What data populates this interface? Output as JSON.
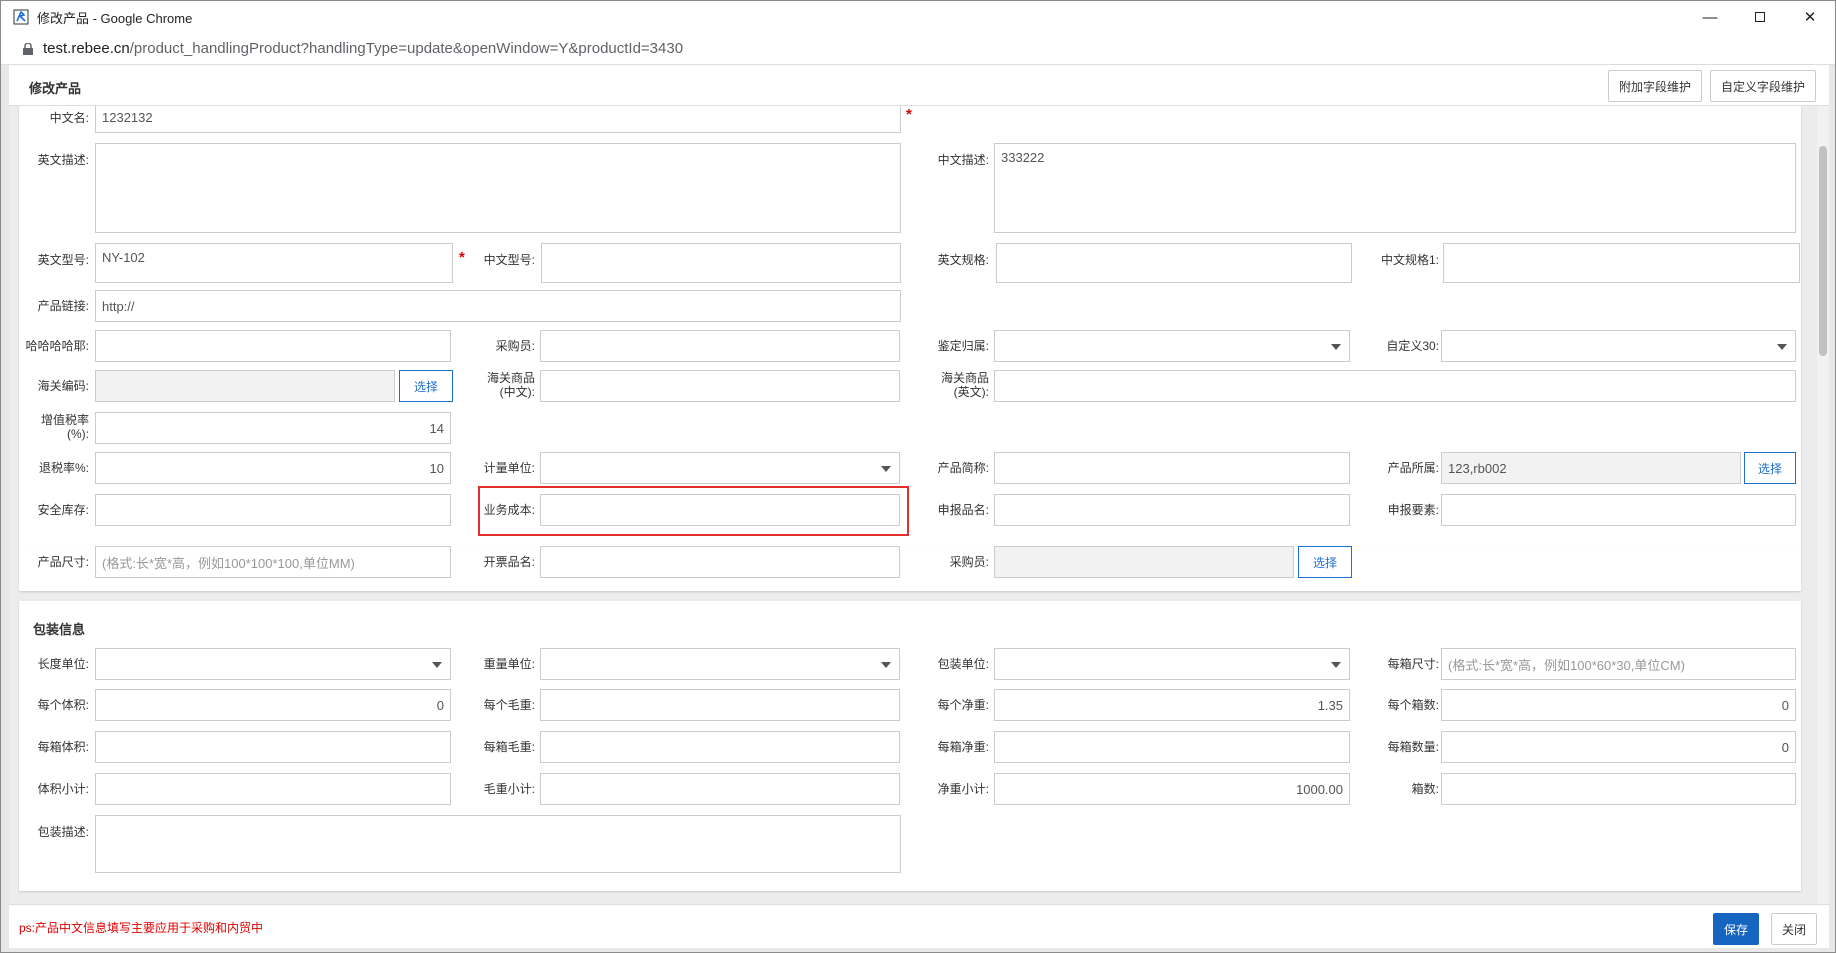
{
  "window": {
    "title": "修改产品 - Google Chrome",
    "url_host": "test.rebee.cn",
    "url_path": "/product_handlingProduct?handlingType=update&openWindow=Y&productId=3430"
  },
  "header": {
    "title": "修改产品",
    "extra_btn": "附加字段维护",
    "custom_btn": "自定义字段维护"
  },
  "basic": {
    "cn_name_label": "中文名:",
    "cn_name": "1232132",
    "required_mark": "*",
    "en_desc_label": "英文描述:",
    "en_desc": "",
    "cn_desc_label": "中文描述:",
    "cn_desc": "333222",
    "en_model_label": "英文型号:",
    "en_model": "NY-102",
    "cn_model_label": "中文型号:",
    "cn_model": "",
    "en_spec_label": "英文规格:",
    "en_spec": "",
    "cn_spec_label": "中文规格1:",
    "cn_spec": "",
    "link_label": "产品链接:",
    "link": "http://",
    "haha_label": "哈哈哈哈耶:",
    "haha": "",
    "buyer_label": "采购员:",
    "buyer": "",
    "identify_label": "鉴定归属:",
    "identify": "",
    "custom30_label": "自定义30:",
    "custom30": "",
    "hs_label": "海关编码:",
    "hs": "",
    "select_btn": "选择",
    "customs_cn_label_1": "海关商品",
    "customs_cn_label_2": "(中文):",
    "customs_cn": "",
    "customs_en_label_1": "海关商品",
    "customs_en_label_2": "(英文):",
    "customs_en": "",
    "vat_label_1": "增值税率",
    "vat_label_2": "(%):",
    "vat": "14",
    "rebate_label": "退税率%:",
    "rebate": "10",
    "unit_label": "计量单位:",
    "unit": "",
    "short_label": "产品简称:",
    "short": "",
    "owner_label": "产品所属:",
    "owner": "123,rb002",
    "stock_label": "安全库存:",
    "stock": "",
    "cost_label": "业务成本:",
    "cost": "",
    "declare_label": "申报品名:",
    "declare": "",
    "elements_label": "申报要素:",
    "elements": "",
    "size_label": "产品尺寸:",
    "size_placeholder": "(格式:长*宽*高，例如100*100*100,单位MM)",
    "invoice_label": "开票品名:",
    "invoice": "",
    "buyer2_label": "采购员:",
    "buyer2": ""
  },
  "packing": {
    "title": "包装信息",
    "len_unit_label": "长度单位:",
    "weight_unit_label": "重量单位:",
    "pack_unit_label": "包装单位:",
    "box_size_label": "每箱尺寸:",
    "box_size_placeholder": "(格式:长*宽*高，例如100*60*30,单位CM)",
    "unit_vol_label": "每个体积:",
    "unit_vol": "0",
    "unit_gross_label": "每个毛重:",
    "unit_gross": "",
    "unit_net_label": "每个净重:",
    "unit_net": "1.35",
    "unit_boxes_label": "每个箱数:",
    "unit_boxes": "0",
    "box_vol_label": "每箱体积:",
    "box_vol": "",
    "box_gross_label": "每箱毛重:",
    "box_gross": "",
    "box_net_label": "每箱净重:",
    "box_net": "",
    "box_qty_label": "每箱数量:",
    "box_qty": "0",
    "vol_total_label": "体积小计:",
    "vol_total": "",
    "gross_total_label": "毛重小计:",
    "gross_total": "",
    "net_total_label": "净重小计:",
    "net_total": "1000.00",
    "boxes_label": "箱数:",
    "boxes": "",
    "desc_label": "包装描述:",
    "desc": ""
  },
  "footer": {
    "note": "ps:产品中文信息填写主要应用于采购和内贸中",
    "save": "保存",
    "close": "关闭"
  }
}
